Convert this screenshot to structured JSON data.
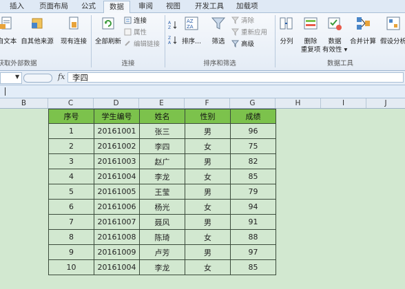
{
  "tabs": [
    "插入",
    "页面布局",
    "公式",
    "数据",
    "审阅",
    "视图",
    "开发工具",
    "加载项"
  ],
  "ribbon": {
    "get_external": {
      "text_btn": "自文本",
      "other_btn": "自其他来源",
      "existing_btn": "现有连接",
      "group_label": "获取外部数据"
    },
    "connections": {
      "refresh_btn": "全部刷新",
      "connect": "连接",
      "properties": "属性",
      "edit_links": "编辑链接",
      "group_label": "连接"
    },
    "sort_filter": {
      "sort_btn": "排序...",
      "filter_btn": "筛选",
      "clear": "清除",
      "reapply": "重新应用",
      "advanced": "高级",
      "group_label": "排序和筛选"
    },
    "data_tools": {
      "split_btn": "分列",
      "remove_dup_1": "删除",
      "remove_dup_2": "重复项",
      "validity_1": "数据",
      "validity_2": "有效性 ▾",
      "consolidate_btn": "合并计算",
      "whatif_btn": "假设分析",
      "group_label": "数据工具"
    }
  },
  "formula_bar": {
    "fx": "fx",
    "content": "李四"
  },
  "columns": [
    "B",
    "C",
    "D",
    "E",
    "F",
    "G",
    "H",
    "I",
    "J"
  ],
  "table": {
    "headers": [
      "序号",
      "学生编号",
      "姓名",
      "性别",
      "成绩"
    ],
    "rows": [
      [
        "1",
        "20161001",
        "张三",
        "男",
        "96"
      ],
      [
        "2",
        "20161002",
        "李四",
        "女",
        "75"
      ],
      [
        "3",
        "20161003",
        "赵广",
        "男",
        "82"
      ],
      [
        "4",
        "20161004",
        "李龙",
        "女",
        "85"
      ],
      [
        "5",
        "20161005",
        "王莹",
        "男",
        "79"
      ],
      [
        "6",
        "20161006",
        "杨光",
        "女",
        "94"
      ],
      [
        "7",
        "20161007",
        "聂风",
        "男",
        "91"
      ],
      [
        "8",
        "20161008",
        "陈琦",
        "女",
        "88"
      ],
      [
        "9",
        "20161009",
        "卢芳",
        "男",
        "97"
      ],
      [
        "10",
        "20161004",
        "李龙",
        "女",
        "85"
      ]
    ]
  },
  "colors": {
    "header_green": "#7cc24c",
    "sheet_bg": "#d2e8d0",
    "ribbon_blue": "#dfe9f5"
  }
}
